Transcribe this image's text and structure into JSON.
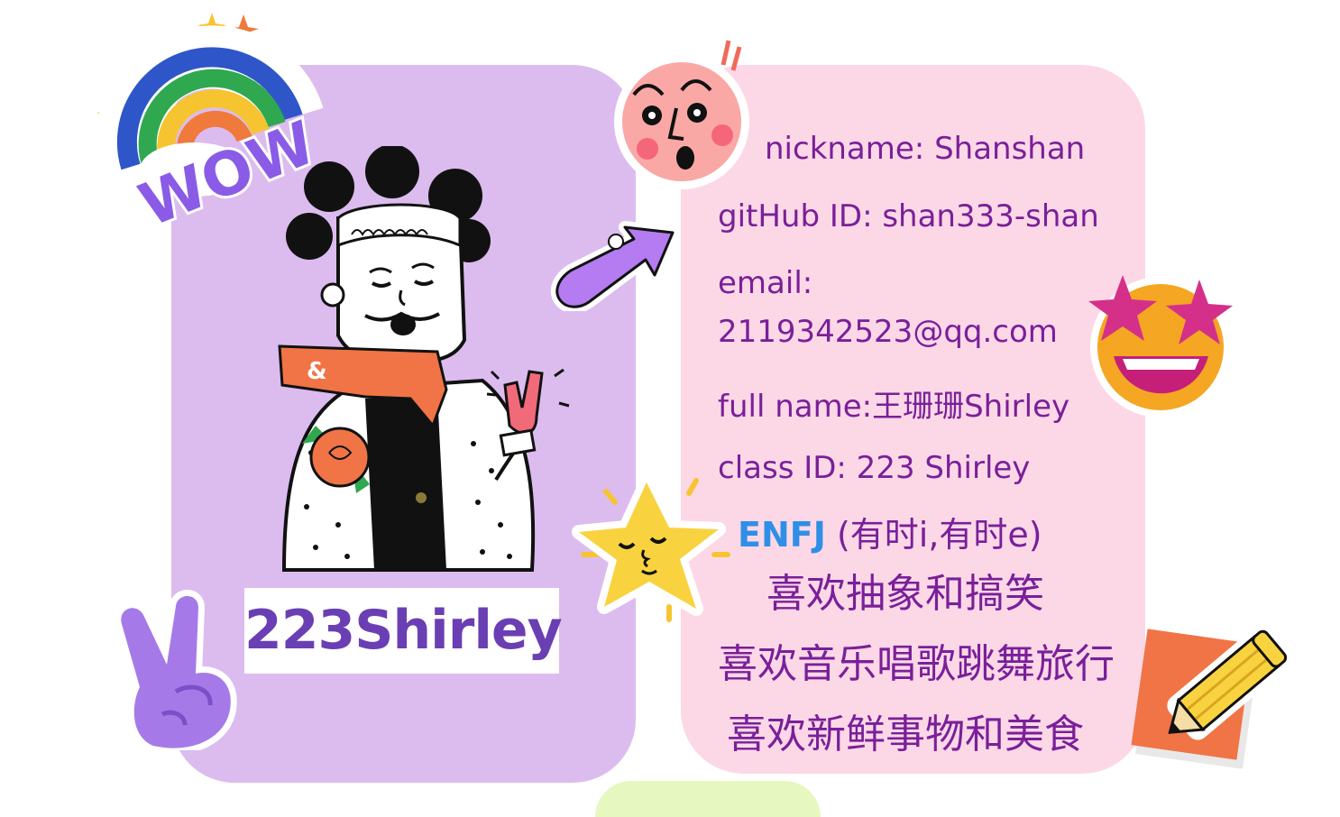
{
  "profile": {
    "display_name": "223Shirley",
    "nickname_line": "nickname:  Shanshan",
    "github_line": "gitHub ID:  shan333-shan",
    "email_label": "email:",
    "email_value": "2119342523@qq.com",
    "fullname_line": "full name:王珊珊Shirley",
    "class_line": "class ID: 223 Shirley",
    "mbti": "ENFJ",
    "mbti_note": " (有时i,有时e)",
    "likes": [
      "喜欢抽象和搞笑",
      "喜欢音乐唱歌跳舞旅行",
      "喜欢新鲜事物和美食"
    ]
  },
  "stickers": {
    "wow_text": "WOW",
    "rainbow": "rainbow-sticker",
    "face": "surprised-face-sticker",
    "arrow": "arrow-sticker",
    "star_eyes": "star-eyes-emoji",
    "star": "smiling-star-sticker",
    "peace": "peace-hand-sticker",
    "pencil": "pencil-note-sticker",
    "avatar": "avatar-illustration",
    "scarf_symbol": "&"
  },
  "colors": {
    "left_card": "#dcbcee",
    "right_card": "#fcd8e6",
    "text": "#7a1f9a",
    "name": "#6a3fb3",
    "mbti": "#2f8fe6"
  }
}
